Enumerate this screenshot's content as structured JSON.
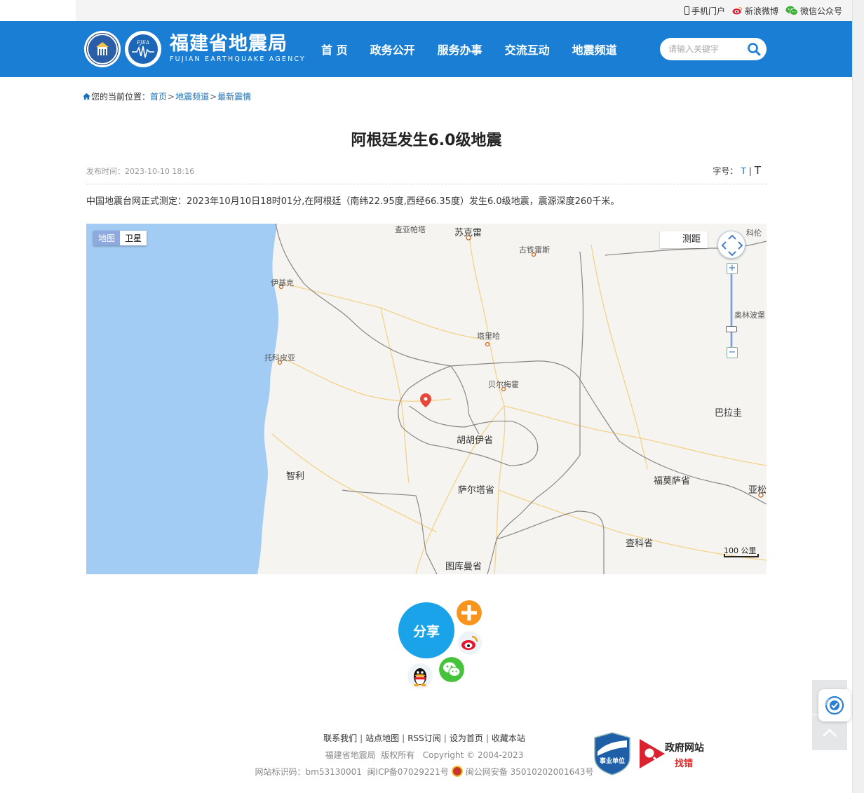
{
  "topbar": {
    "mobile": "手机门户",
    "weibo": "新浪微博",
    "wechat": "微信公众号"
  },
  "header": {
    "logo_cn": "福建省地震局",
    "logo_en": "FUJIAN EARTHQUAKE AGENCY",
    "emblem2_text": "FJEA",
    "nav": [
      "首 页",
      "政务公开",
      "服务办事",
      "交流互动",
      "地震频道"
    ],
    "search_placeholder": "请输入关键字"
  },
  "breadcrumb": {
    "prefix": "您的当前位置：",
    "items": [
      "首页",
      "地震频道",
      "最新震情"
    ],
    "separator": ">"
  },
  "article": {
    "title": "阿根廷发生6.0级地震",
    "publish_label": "发布时间：",
    "publish_time": "2023-10-10 18:16",
    "font_label": "字号：",
    "font_small": "T",
    "font_divider": "|",
    "font_large": "T",
    "body": "中国地震台网正式测定：2023年10月10日18时01分,在阿根廷（南纬22.95度,西经66.35度）发生6.0级地震，震源深度260千米。"
  },
  "map": {
    "type_map": "地图",
    "type_satellite": "卫星",
    "active_type": "地图",
    "measure": "测距",
    "scale_label": "100 公里",
    "labels": {
      "chapaca": "查亚帕塔",
      "sucre": "苏克雷",
      "camargo": "古铁雷斯",
      "kebi": "科伦",
      "iquique": "伊基克",
      "tarija": "塔里哈",
      "tocopilla": "托科皮亚",
      "olivo": "奥林波堡",
      "bermejo": "贝尔梅霍",
      "paraguay": "巴拉圭",
      "jujuy": "胡胡伊省",
      "chile": "智利",
      "salta": "萨尔塔省",
      "formosa": "福莫萨省",
      "asuncion": "亚松",
      "chaco": "查科省",
      "tucuman": "图库曼省"
    },
    "colors": {
      "ocean": "#a3ccf5",
      "land": "#f5f4f0",
      "marker": "#e8463a",
      "border": "#888888",
      "road": "#f3d38a"
    }
  },
  "share": {
    "label": "分享",
    "buttons": [
      "add-icon",
      "weibo-icon",
      "wechat-icon",
      "qq-icon"
    ]
  },
  "footer": {
    "links": [
      "联系我们",
      "站点地图",
      "RSS订阅",
      "设为首页",
      "收藏本站"
    ],
    "copyright_owner": "福建省地震局",
    "rights": "版权所有",
    "copyright": "Copyright © 2004-2023",
    "site_id": "网站标识码：bm53130001",
    "icp": "闽ICP备07029221号",
    "police": "闽公网安备 35010202001643号",
    "badge_unit": "事业单位",
    "badge_gov_1": "政府网站",
    "badge_gov_2": "找错"
  }
}
